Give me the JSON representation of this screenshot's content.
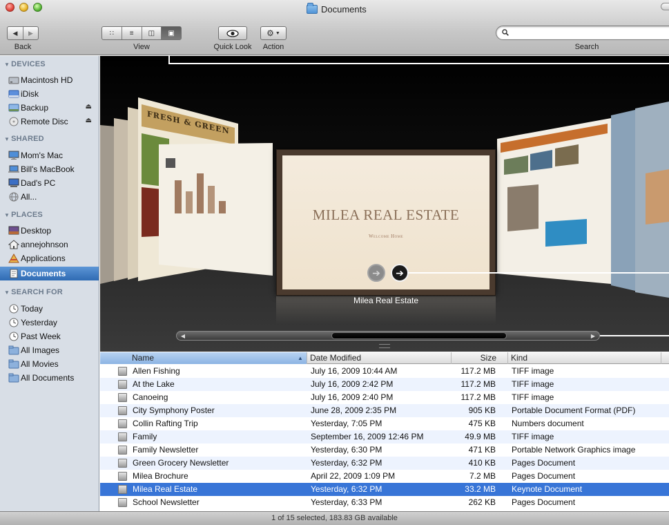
{
  "window": {
    "title": "Documents"
  },
  "toolbar": {
    "back_label": "Back",
    "view_label": "View",
    "quicklook_label": "Quick Look",
    "action_label": "Action",
    "search_label": "Search",
    "search_value": "",
    "view_modes": [
      "icon",
      "list",
      "column",
      "cover-flow"
    ],
    "active_view": "cover-flow"
  },
  "sidebar": {
    "devices": {
      "header": "DEVICES",
      "items": [
        {
          "label": "Macintosh HD",
          "icon": "hard-drive-icon"
        },
        {
          "label": "iDisk",
          "icon": "idisk-icon"
        },
        {
          "label": "Backup",
          "icon": "backup-drive-icon",
          "eject": true
        },
        {
          "label": "Remote Disc",
          "icon": "remote-disc-icon",
          "eject": true
        }
      ]
    },
    "shared": {
      "header": "SHARED",
      "items": [
        {
          "label": "Mom's Mac",
          "icon": "computer-icon"
        },
        {
          "label": "Bill's MacBook",
          "icon": "computer-icon"
        },
        {
          "label": "Dad's PC",
          "icon": "pc-icon"
        },
        {
          "label": "All...",
          "icon": "network-icon"
        }
      ]
    },
    "places": {
      "header": "PLACES",
      "items": [
        {
          "label": "Desktop",
          "icon": "desktop-icon"
        },
        {
          "label": "annejohnson",
          "icon": "home-icon"
        },
        {
          "label": "Applications",
          "icon": "applications-icon"
        },
        {
          "label": "Documents",
          "icon": "documents-icon",
          "selected": true
        }
      ]
    },
    "search_for": {
      "header": "SEARCH FOR",
      "items": [
        {
          "label": "Today",
          "icon": "clock-icon"
        },
        {
          "label": "Yesterday",
          "icon": "clock-icon"
        },
        {
          "label": "Past Week",
          "icon": "clock-icon"
        },
        {
          "label": "All Images",
          "icon": "smart-folder-icon"
        },
        {
          "label": "All Movies",
          "icon": "smart-folder-icon"
        },
        {
          "label": "All Documents",
          "icon": "smart-folder-icon"
        }
      ]
    }
  },
  "coverflow": {
    "cover_title": "MILEA REAL ESTATE",
    "cover_subtitle": "Welcome Home",
    "caption": "Milea Real Estate",
    "left_cover_heading": "FRESH & GREEN"
  },
  "list": {
    "columns": {
      "name": "Name",
      "date": "Date Modified",
      "size": "Size",
      "kind": "Kind"
    },
    "rows": [
      {
        "name": "Allen Fishing",
        "date": "July 16, 2009 10:44 AM",
        "size": "117.2 MB",
        "kind": "TIFF image"
      },
      {
        "name": "At the Lake",
        "date": "July 16, 2009 2:42 PM",
        "size": "117.2 MB",
        "kind": "TIFF image"
      },
      {
        "name": "Canoeing",
        "date": "July 16, 2009 2:40 PM",
        "size": "117.2 MB",
        "kind": "TIFF image"
      },
      {
        "name": "City Symphony Poster",
        "date": "June 28, 2009 2:35 PM",
        "size": "905 KB",
        "kind": "Portable Document Format (PDF)"
      },
      {
        "name": "Collin Rafting Trip",
        "date": "Yesterday, 7:05 PM",
        "size": "475 KB",
        "kind": "Numbers document"
      },
      {
        "name": "Family",
        "date": "September 16, 2009 12:46 PM",
        "size": "49.9 MB",
        "kind": "TIFF image"
      },
      {
        "name": "Family Newsletter",
        "date": "Yesterday, 6:30 PM",
        "size": "471 KB",
        "kind": "Portable Network Graphics image"
      },
      {
        "name": "Green Grocery Newsletter",
        "date": "Yesterday, 6:32 PM",
        "size": "410 KB",
        "kind": "Pages Document"
      },
      {
        "name": "Milea Brochure",
        "date": "April 22, 2009 1:09 PM",
        "size": "7.2 MB",
        "kind": "Pages Document"
      },
      {
        "name": "Milea Real Estate",
        "date": "Yesterday, 6:32 PM",
        "size": "33.2 MB",
        "kind": "Keynote Document",
        "selected": true
      },
      {
        "name": "School Newsletter",
        "date": "Yesterday, 6:33 PM",
        "size": "262 KB",
        "kind": "Pages Document"
      }
    ]
  },
  "status": {
    "text": "1 of 15 selected, 183.83 GB available"
  },
  "colors": {
    "selection": "#3875d7",
    "sidebar_bg": "#d8dee6",
    "sidebar_header": "#6b7a8c"
  }
}
